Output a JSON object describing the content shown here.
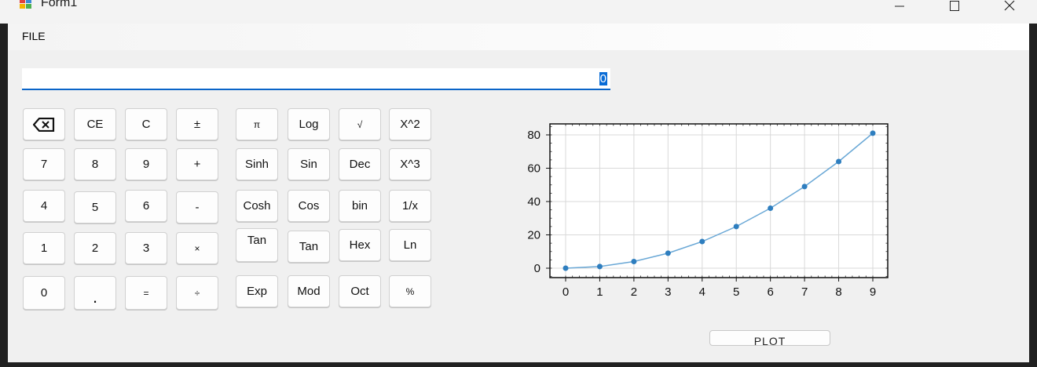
{
  "window": {
    "title": "Form1",
    "controls": [
      "minimize-icon",
      "maximize-icon",
      "close-icon"
    ]
  },
  "menu": {
    "file": "FILE"
  },
  "display": {
    "value": "0"
  },
  "keypad": {
    "backspace": "backspace-icon",
    "ce": "CE",
    "c": "C",
    "plus_minus": "±",
    "seven": "7",
    "eight": "8",
    "nine": "9",
    "plus": "+",
    "four": "4",
    "five": "5",
    "six": "6",
    "minus": "-",
    "one": "1",
    "two": "2",
    "three": "3",
    "times": "×",
    "zero": "0",
    "dot": ".",
    "equals": "=",
    "divide": "÷"
  },
  "scientific": {
    "pi": "π",
    "log": "Log",
    "sqrt": "√",
    "x2": "X^2",
    "sinh": "Sinh",
    "sin": "Sin",
    "dec": "Dec",
    "x3": "X^3",
    "cosh": "Cosh",
    "cos": "Cos",
    "bin": "bin",
    "inv": "1/x",
    "tanh": "Tan",
    "tan": "Tan",
    "hex": "Hex",
    "ln": "Ln",
    "exp": "Exp",
    "mod": "Mod",
    "oct": "Oct",
    "percent": "%"
  },
  "plot_button": "PLOT",
  "colors": {
    "accent": "#0a64c8",
    "series": "#2e7ebf",
    "line": "#6aa8d6"
  },
  "chart_data": {
    "type": "line",
    "x": [
      0,
      1,
      2,
      3,
      4,
      5,
      6,
      7,
      8,
      9
    ],
    "series": [
      {
        "values": [
          0,
          1,
          4,
          9,
          16,
          25,
          36,
          49,
          64,
          81
        ]
      }
    ],
    "xlim": [
      0,
      9
    ],
    "ylim": [
      0,
      85
    ],
    "xticks": [
      "0",
      "1",
      "2",
      "3",
      "4",
      "5",
      "6",
      "7",
      "8",
      "9"
    ],
    "yticks": [
      "0",
      "20",
      "40",
      "60",
      "80"
    ],
    "grid": true,
    "title": "",
    "xlabel": "",
    "ylabel": ""
  }
}
